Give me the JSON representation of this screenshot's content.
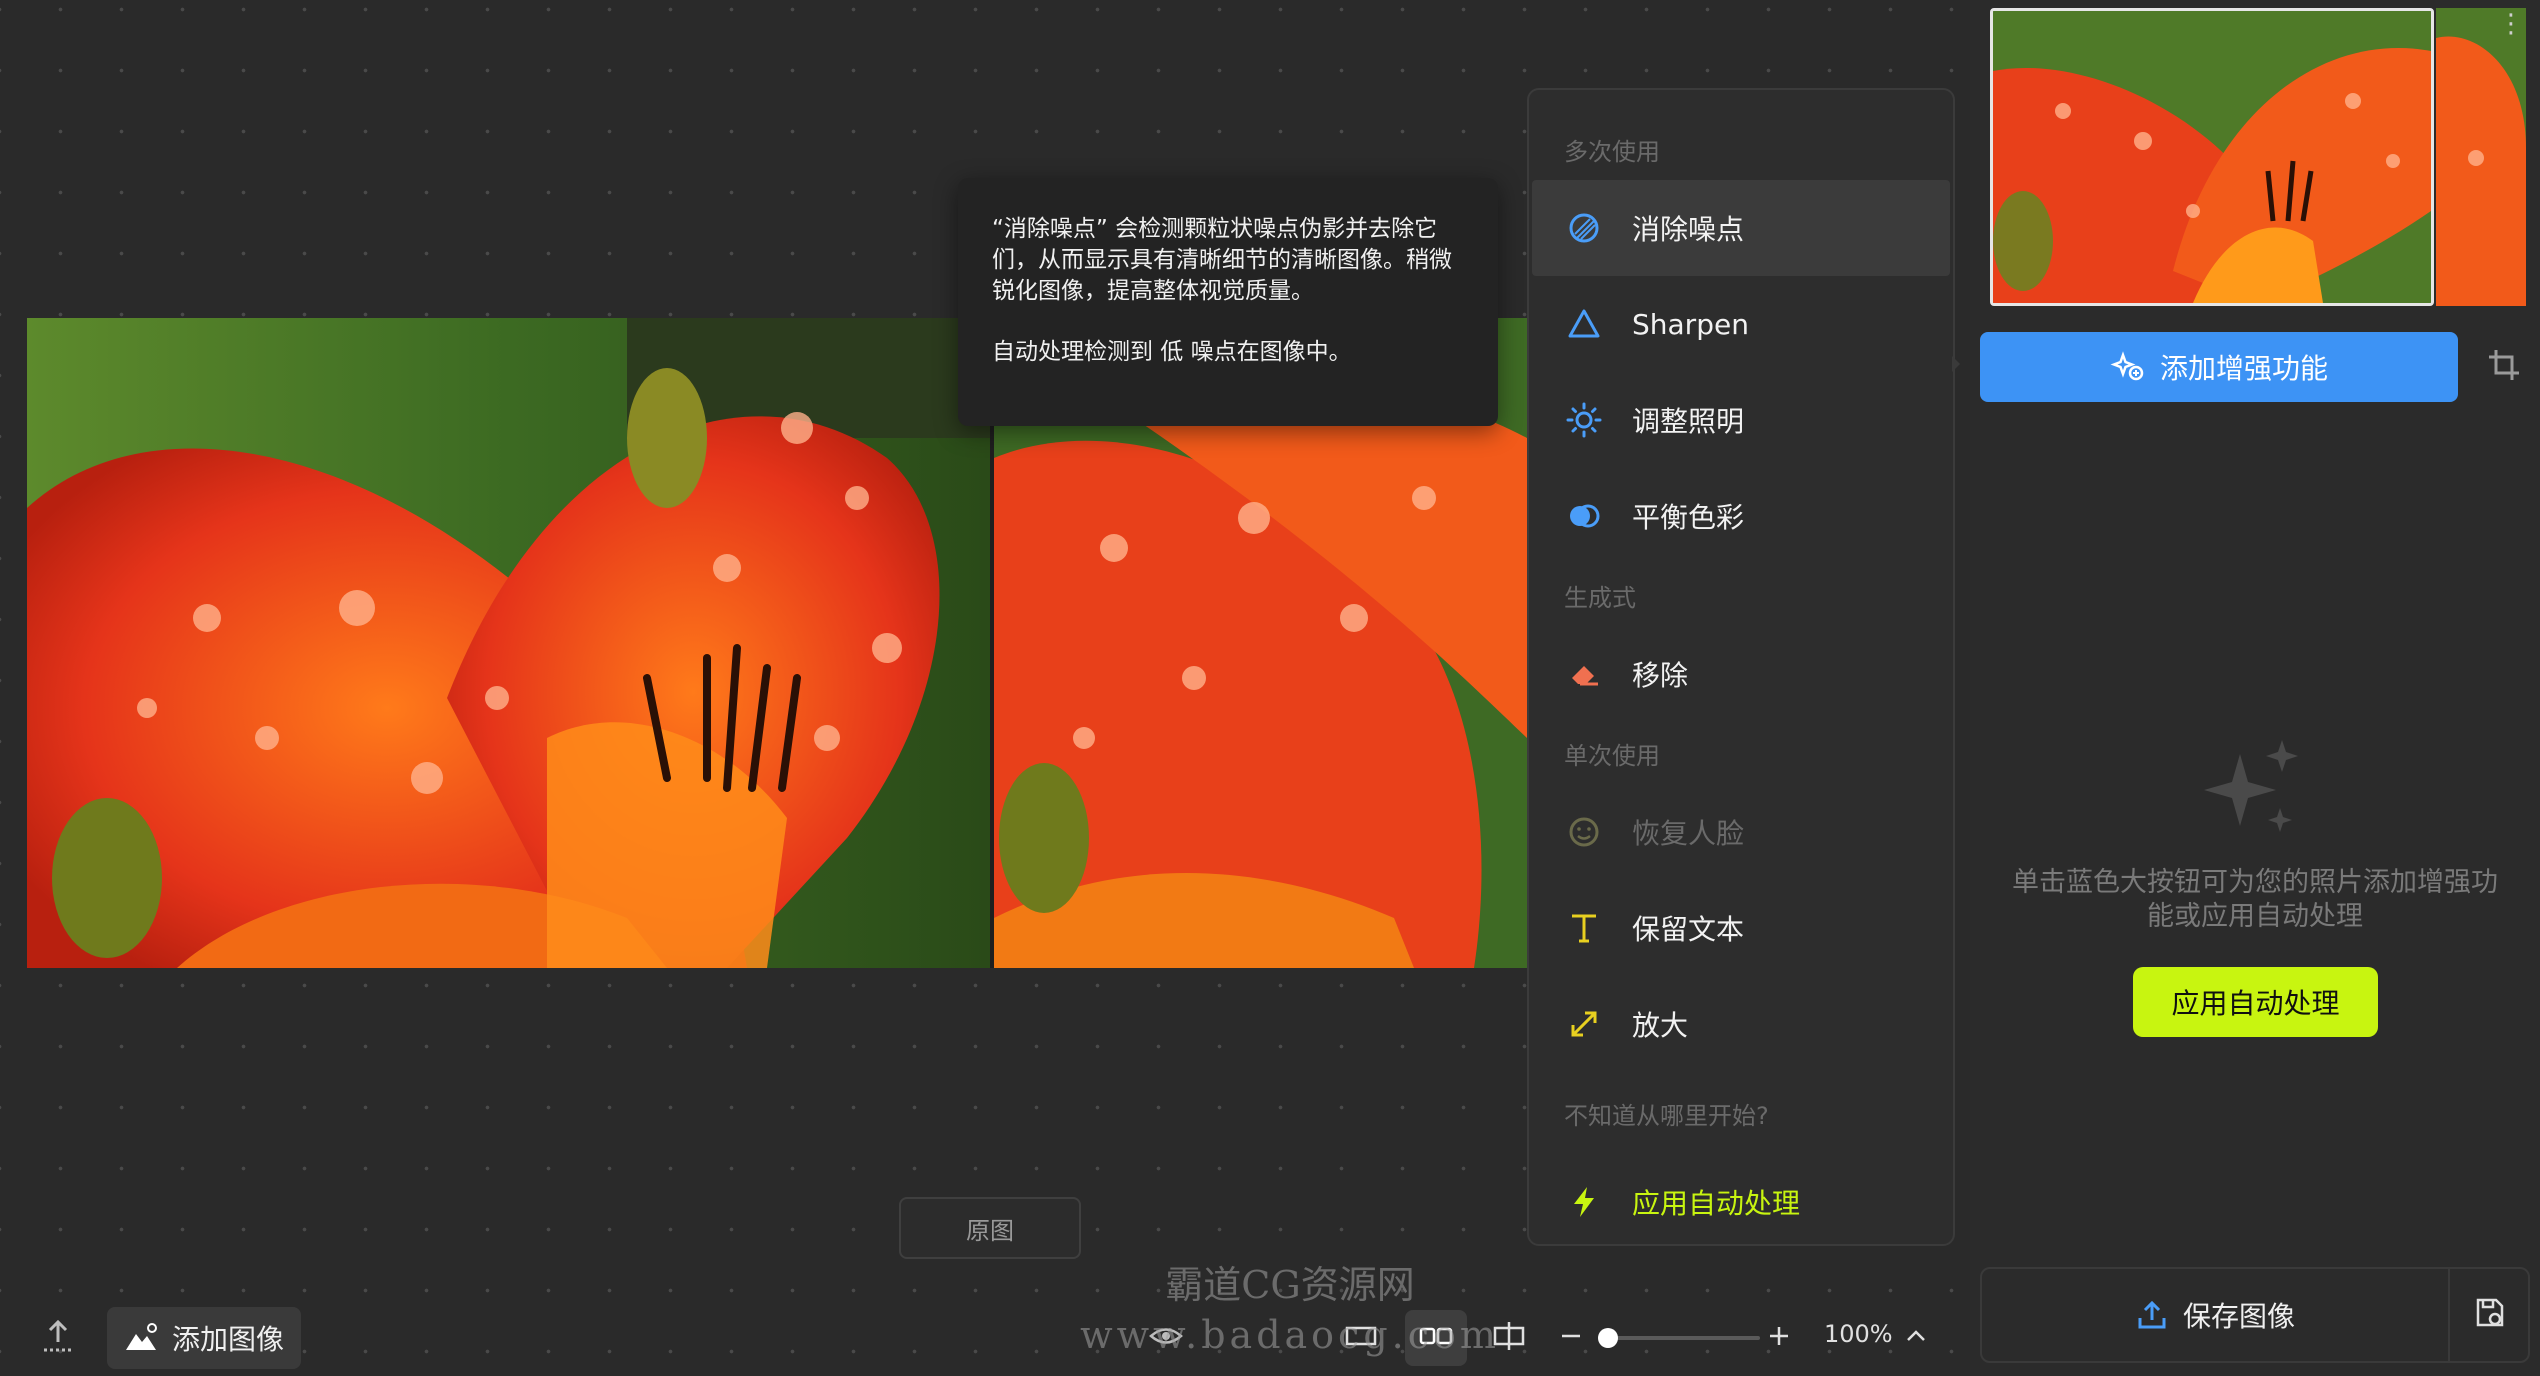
{
  "tooltip": {
    "description": "“消除噪点” 会检测颗粒状噪点伪影并去除它们，从而显示具有清晰细节的清晰图像。稍微锐化图像，提高整体视觉质量。",
    "detection": "自动处理检测到 低 噪点在图像中。"
  },
  "menu": {
    "section_multi": "多次使用",
    "denoise": "消除噪点",
    "sharpen": "Sharpen",
    "lighting": "调整照明",
    "color": "平衡色彩",
    "section_generative": "生成式",
    "remove": "移除",
    "section_single": "单次使用",
    "face": "恢复人脸",
    "text": "保留文本",
    "upscale": "放大",
    "section_help": "不知道从哪里开始?",
    "auto": "应用自动处理"
  },
  "panel": {
    "enhance_label": "添加增强功能",
    "hint": "单击蓝色大按钮可为您的照片添加增强功能或应用自动处理",
    "auto_label": "应用自动处理",
    "save_label": "保存图像"
  },
  "toolbar": {
    "original_label": "原图",
    "add_image_label": "添加图像",
    "zoom": "100%"
  },
  "watermark": {
    "line1": "霸道CG资源网",
    "line2": "www.badaocg.com"
  },
  "colors": {
    "accent_blue": "#3d93f5",
    "accent_lime": "#c8f510",
    "background": "#2b2b2b"
  }
}
